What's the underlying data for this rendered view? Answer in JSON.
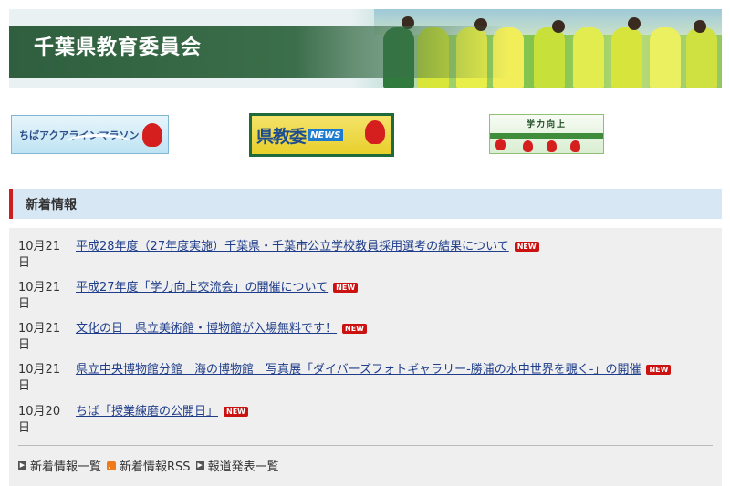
{
  "header": {
    "title": "千葉県教育委員会"
  },
  "banners": [
    {
      "label": "ちばアクアラインマラソン"
    },
    {
      "label": "県教委",
      "tag": "NEWS"
    },
    {
      "label": "学力向上"
    }
  ],
  "section": {
    "title": "新着情報"
  },
  "news": [
    {
      "date": "10月21日",
      "title": "平成28年度（27年度実施）千葉県・千葉市公立学校教員採用選考の結果について",
      "badge": "NEW"
    },
    {
      "date": "10月21日",
      "title": "平成27年度「学力向上交流会」の開催について",
      "badge": "NEW"
    },
    {
      "date": "10月21日",
      "title": "文化の日　県立美術館・博物館が入場無料です！",
      "badge": "NEW"
    },
    {
      "date": "10月21日",
      "title": "県立中央博物館分館　海の博物館　写真展「ダイバーズフォトギャラリー-勝浦の水中世界を覗く-」の開催",
      "badge": "NEW"
    },
    {
      "date": "10月20日",
      "title": "ちば「授業練磨の公開日」",
      "badge": "NEW"
    }
  ],
  "footer": {
    "links": [
      "新着情報一覧",
      "新着情報RSS",
      "報道発表一覧"
    ]
  },
  "colors": {
    "accent_red": "#cc1f1f",
    "link_blue": "#1f3d8a",
    "header_green": "#2f5f3e"
  },
  "icons": [
    "arrow-icon",
    "rss-icon",
    "mascot-icon"
  ]
}
